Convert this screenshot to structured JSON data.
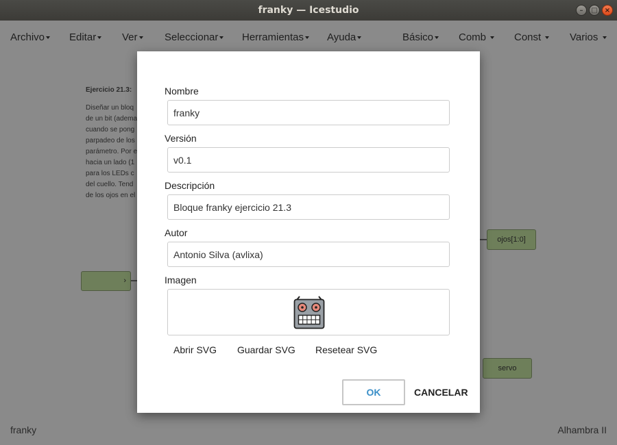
{
  "window": {
    "title": "franky — Icestudio",
    "controls": [
      "minimize-icon",
      "maximize-icon",
      "close-icon"
    ]
  },
  "menubar": {
    "left": [
      "Archivo",
      "Editar",
      "Ver",
      "Seleccionar",
      "Herramientas",
      "Ayuda"
    ],
    "right": [
      "Básico",
      "Comb",
      "Const",
      "Varios"
    ]
  },
  "canvas": {
    "info_title": "Ejercicio 21.3:",
    "info_lines": [
      "Diseñar un bloq",
      "de un bit (adema",
      "cuando se pong",
      "parpadeo de los",
      "parámetro. Por e",
      "hacia un lado (1",
      "para los LEDs c",
      "del cuello. Tend",
      "de los ojos en el"
    ],
    "blocks": {
      "ojos": "ojos[1:0]",
      "servo": "servo",
      "input_arrow": "›"
    }
  },
  "statusbar": {
    "left": "franky",
    "right": "Alhambra II"
  },
  "dialog": {
    "name_label": "Nombre",
    "name_value": "franky",
    "version_label": "Versión",
    "version_value": "v0.1",
    "description_label": "Descripción",
    "description_value": "Bloque franky ejercicio 21.3",
    "author_label": "Autor",
    "author_value": "Antonio Silva (avlixa)",
    "image_label": "Imagen",
    "image_icon": "robot-icon",
    "open_svg": "Abrir SVG",
    "save_svg": "Guardar SVG",
    "reset_svg": "Resetear SVG",
    "ok": "OK",
    "cancel": "CANCELAR"
  },
  "colors": {
    "accent": "#3a8fc8",
    "overlay": "#8a8a8a",
    "block_green": "#6e7f5a",
    "titlebar": "#3c3b37",
    "close_button": "#e95420"
  }
}
